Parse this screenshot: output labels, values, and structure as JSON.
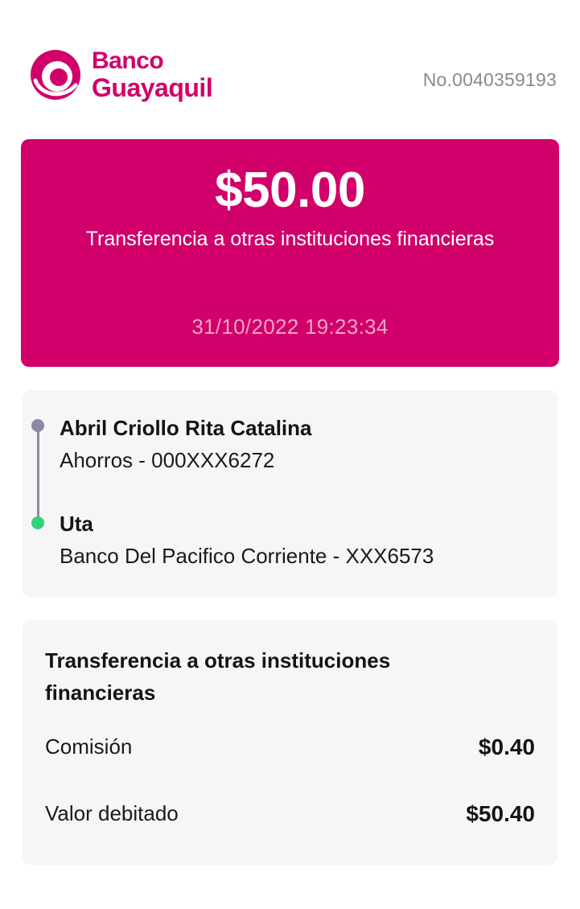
{
  "header": {
    "brand_line1": "Banco",
    "brand_line2": "Guayaquil",
    "receipt_number": "No.0040359193",
    "brand_color": "#d1006a"
  },
  "amount_card": {
    "amount": "$50.00",
    "description": "Transferencia a otras instituciones financieras",
    "datetime": "31/10/2022 19:23:34",
    "background_color": "#d1006a"
  },
  "parties": {
    "from": {
      "name": "Abril Criollo Rita Catalina",
      "detail": "Ahorros - 000XXX6272",
      "dot_color": "#8a8aa3"
    },
    "to": {
      "name": "Uta",
      "detail": "Banco Del Pacifico Corriente - XXX6573",
      "dot_color": "#2fd27a"
    }
  },
  "details": {
    "title": "Transferencia a otras instituciones financieras",
    "rows": [
      {
        "label": "Comisión",
        "value": "$0.40"
      },
      {
        "label": "Valor debitado",
        "value": "$50.40"
      }
    ]
  }
}
